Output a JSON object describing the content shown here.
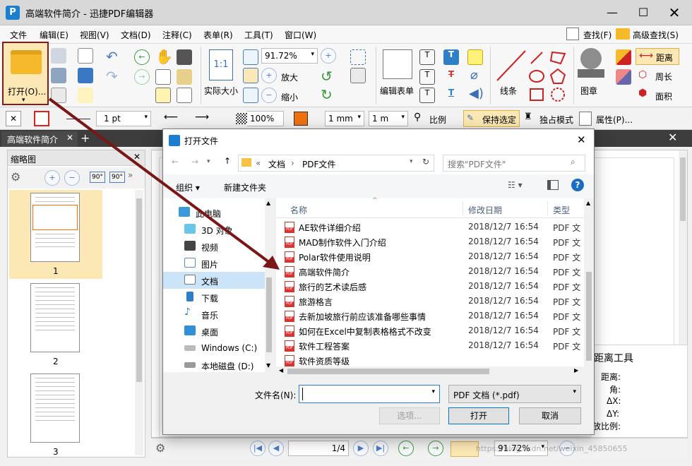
{
  "window": {
    "title": "高端软件简介 - 迅捷PDF编辑器",
    "logo": "P"
  },
  "menu": [
    "文件",
    "编辑(E)",
    "视图(V)",
    "文档(D)",
    "注释(C)",
    "表单(R)",
    "工具(T)",
    "窗口(W)"
  ],
  "menu_right": {
    "find": "查找(F)",
    "adv_find": "高级查找(S)"
  },
  "ribbon": {
    "open": "打开(O)...",
    "zoom_value": "91.72%",
    "zoom_in": "放大",
    "zoom_out": "缩小",
    "actual_size": "实际大小",
    "actual_size_icon": "1:1",
    "edit_form": "编辑表单",
    "line": "线条",
    "stamp": "图章",
    "distance": "距离",
    "perimeter": "周长",
    "area": "面积"
  },
  "toolbar2": {
    "line_width": "1 pt",
    "opacity": "100%",
    "unit1": "1 mm",
    "unit2": "1 m",
    "scale": "比例",
    "keep_selected": "保持选定",
    "exclusive": "独占模式",
    "properties": "属性(P)..."
  },
  "tab": {
    "label": "高端软件简介"
  },
  "sidebar": {
    "title": "缩略图",
    "rot_left": "90°",
    "rot_right": "90°",
    "pages": [
      "1",
      "2",
      "3"
    ]
  },
  "distance_panel": {
    "title": "距离工具",
    "rows": [
      "距离:",
      "角:",
      "ΔX:",
      "ΔY:",
      "放比例:"
    ]
  },
  "bottombar": {
    "page": "1/4",
    "zoom": "91.72%"
  },
  "watermark": "https://blog.csdn.net/weixin_45850655",
  "dialog": {
    "title": "打开文件",
    "breadcrumb": [
      "«",
      "文档",
      "›",
      "PDF文件"
    ],
    "search_placeholder": "搜索\"PDF文件\"",
    "organize": "组织 ▾",
    "new_folder": "新建文件夹",
    "nav": [
      "此电脑",
      "3D 对象",
      "视频",
      "图片",
      "文档",
      "下载",
      "音乐",
      "桌面",
      "Windows (C:)",
      "本地磁盘 (D:)"
    ],
    "columns": {
      "name": "名称",
      "date": "修改日期",
      "type": "类型"
    },
    "files": [
      {
        "name": "AE软件详细介绍",
        "date": "2018/12/7 16:54",
        "type": "PDF 文"
      },
      {
        "name": "MAD制作软件入门介绍",
        "date": "2018/12/7 16:54",
        "type": "PDF 文"
      },
      {
        "name": "Polar软件使用说明",
        "date": "2018/12/7 16:54",
        "type": "PDF 文"
      },
      {
        "name": "高端软件简介",
        "date": "2018/12/7 16:54",
        "type": "PDF 文"
      },
      {
        "name": "旅行的艺术读后感",
        "date": "2018/12/7 16:54",
        "type": "PDF 文"
      },
      {
        "name": "旅游格言",
        "date": "2018/12/7 16:54",
        "type": "PDF 文"
      },
      {
        "name": "去新加坡旅行前应该准备哪些事情",
        "date": "2018/12/7 16:54",
        "type": "PDF 文"
      },
      {
        "name": "如何在Excel中复制表格格式不改变",
        "date": "2018/12/7 16:54",
        "type": "PDF 文"
      },
      {
        "name": "软件工程答案",
        "date": "2018/12/7 16:54",
        "type": "PDF 文"
      },
      {
        "name": "软件资质等级",
        "date": "",
        "type": ""
      }
    ],
    "filename_label": "文件名(N):",
    "filename_value": "",
    "filetype": "PDF 文档 (*.pdf)",
    "options": "选项...",
    "open": "打开",
    "cancel": "取消"
  },
  "colors": {
    "accent": "#1a7fd0",
    "highlight_border": "#8b1a1a",
    "arrow": "#7b1616",
    "selected": "#fbe8b4"
  }
}
